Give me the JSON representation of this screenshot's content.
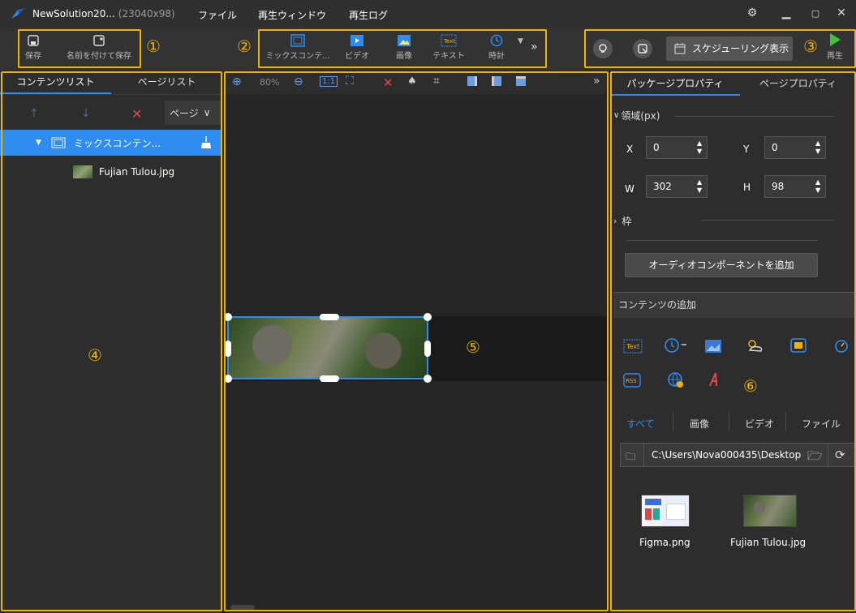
{
  "titlebar": {
    "app_name": "NewSolution20...",
    "resolution": "(23040x98)",
    "menu": [
      "ファイル",
      "再生ウィンドウ",
      "再生ログ"
    ]
  },
  "toolbar": {
    "save": "保存",
    "save_as": "名前を付けて保存",
    "mix_content": "ミックスコンテ...",
    "video": "ビデオ",
    "image": "画像",
    "text": "テキスト",
    "clock": "時計",
    "schedule": "スケジューリング表示",
    "play": "再生"
  },
  "callouts": [
    "①",
    "②",
    "③",
    "④",
    "⑤",
    "⑥"
  ],
  "left_panel": {
    "tabs": [
      "コンテンツリスト",
      "ページリスト"
    ],
    "page_dropdown": "ページ",
    "tree": {
      "parent": "ミックスコンテン...",
      "child": "Fujian Tulou.jpg"
    }
  },
  "canvas_toolbar": {
    "zoom": "80%"
  },
  "right_panel": {
    "tabs": [
      "パッケージプロパティ",
      "ページプロパティ"
    ],
    "region_title": "領域(px)",
    "fields": {
      "x_label": "X",
      "x": "0",
      "y_label": "Y",
      "y": "0",
      "w_label": "W",
      "w": "302",
      "h_label": "H",
      "h": "98"
    },
    "border_title": "枠",
    "add_audio": "オーディオコンポーネントを追加",
    "add_content_title": "コンテンツの追加",
    "filter_tabs": [
      "すべて",
      "画像",
      "ビデオ",
      "ファイル"
    ],
    "path": "C:\\Users\\Nova000435\\Desktop",
    "files": [
      "Figma.png",
      "Fujian Tulou.jpg"
    ]
  },
  "colors": {
    "accent": "#2f8cf0",
    "highlight": "#f0b400",
    "selection": "#2f8cf0"
  }
}
